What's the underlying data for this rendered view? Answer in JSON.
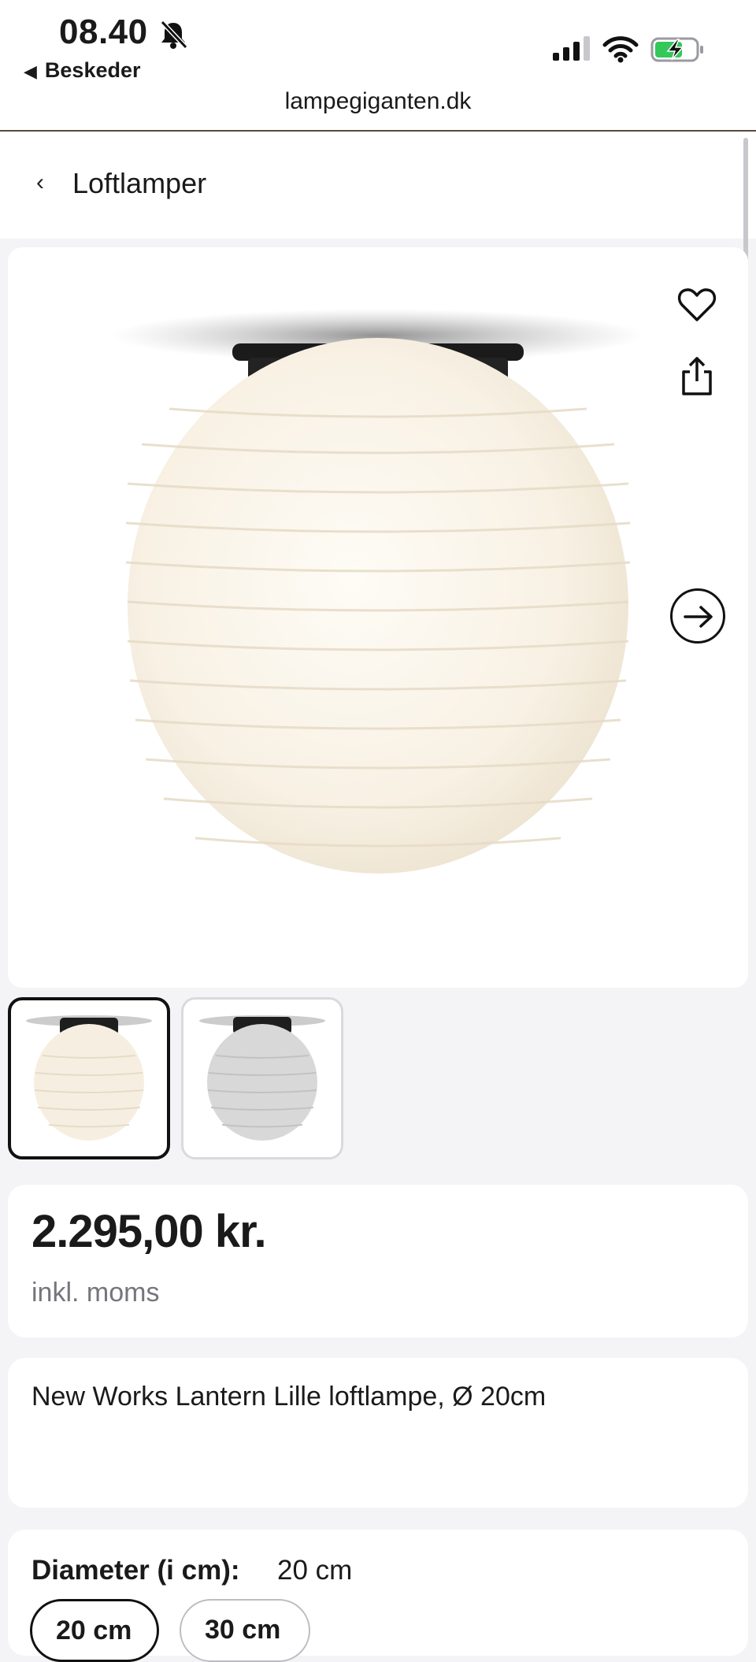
{
  "status_bar": {
    "time": "08.40",
    "back_app": "Beskeder",
    "url": "lampegiganten.dk"
  },
  "breadcrumb": {
    "label": "Loftlamper"
  },
  "product_image": {
    "alt": "New Works Lantern Lille loftlampe",
    "icons": [
      "heart-icon",
      "share-icon",
      "arrow-right-icon"
    ]
  },
  "price": {
    "amount": "2.295,00 kr.",
    "note": "inkl. moms"
  },
  "product": {
    "title": "New Works Lantern Lille loftlampe, Ø 20cm"
  },
  "variant": {
    "label": "Diameter (i cm):",
    "selected": "20 cm",
    "options": [
      "20 cm",
      "30 cm"
    ]
  },
  "colors": {
    "text": "#1a1a1a",
    "muted": "#75757c",
    "background": "#f4f4f6",
    "battery": "#34c759"
  }
}
